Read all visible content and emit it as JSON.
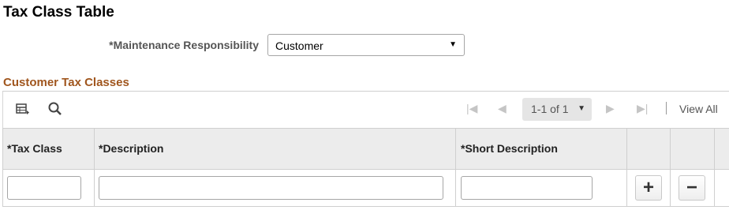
{
  "page": {
    "title": "Tax Class Table"
  },
  "maintenance": {
    "label": "*Maintenance Responsibility",
    "selected": "Customer",
    "arrow": "▼"
  },
  "grid": {
    "title": "Customer Tax Classes",
    "toolbar": {
      "personalize_icon": "grid-personalize-icon",
      "find_icon": "search-icon",
      "first": "|◀",
      "prev": "◀",
      "pager": "1-1 of 1",
      "pager_arrow": "▼",
      "next": "▶",
      "last": "▶|",
      "view_all": "View All"
    },
    "columns": [
      "*Tax Class",
      "*Description",
      "*Short Description"
    ],
    "rows": [
      {
        "tax_class": "",
        "description": "",
        "short_description": ""
      }
    ],
    "add_symbol": "+",
    "delete_symbol": "−"
  }
}
